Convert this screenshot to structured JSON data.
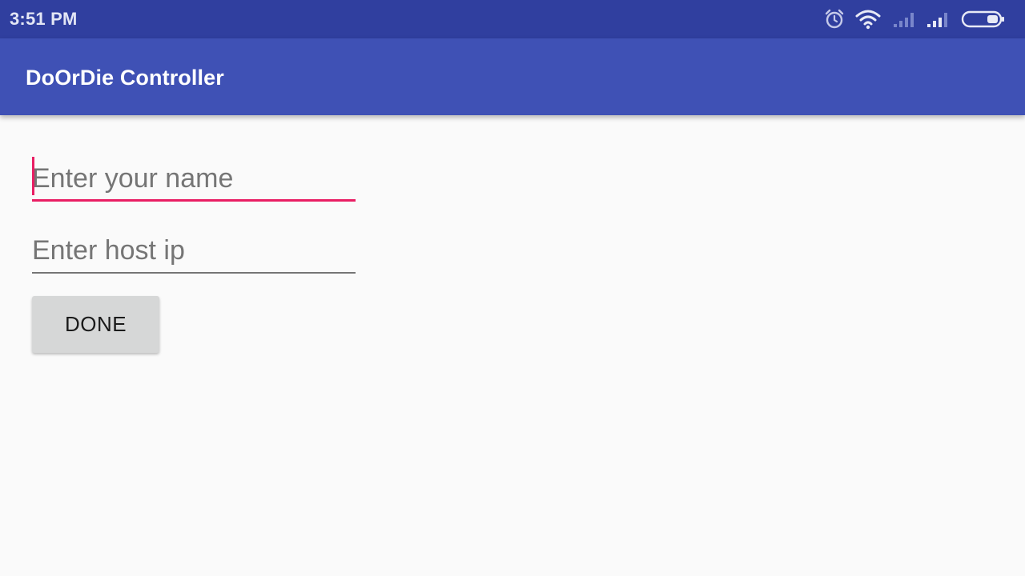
{
  "status_bar": {
    "time": "3:51 PM",
    "icons": [
      "alarm-icon",
      "wifi-icon",
      "signal-icon",
      "signal-icon",
      "battery-icon"
    ],
    "color": "#303f9f"
  },
  "app_bar": {
    "title": "DoOrDie Controller",
    "color": "#3f51b5"
  },
  "form": {
    "name_field": {
      "placeholder": "Enter your name",
      "value": ""
    },
    "host_field": {
      "placeholder": "Enter host ip",
      "value": ""
    },
    "done_label": "DONE",
    "accent_color": "#e91e63"
  }
}
